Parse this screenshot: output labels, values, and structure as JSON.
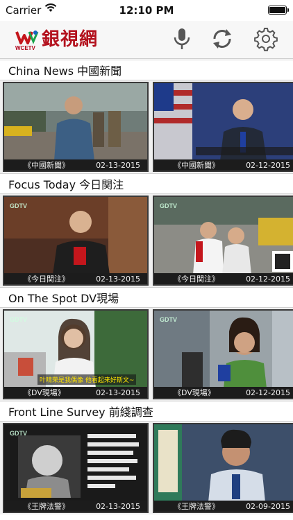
{
  "status_bar": {
    "carrier": "Carrier",
    "time": "12:10 PM"
  },
  "nav": {
    "brand_small": "WCETV",
    "brand_name": "銀視網",
    "icons": [
      "microphone-icon",
      "refresh-icon",
      "gear-icon"
    ]
  },
  "sections": [
    {
      "title": "China News 中國新聞",
      "items": [
        {
          "program": "《中國新聞》",
          "date": "02-13-2015"
        },
        {
          "program": "《中國新聞》",
          "date": "02-12-2015"
        }
      ]
    },
    {
      "title": "Focus Today 今日関注",
      "items": [
        {
          "program": "《今日関注》",
          "date": "02-13-2015"
        },
        {
          "program": "《今日関注》",
          "date": "02-12-2015"
        }
      ]
    },
    {
      "title": "On The Spot DV現場",
      "items": [
        {
          "program": "《DV現場》",
          "date": "02-13-2015",
          "subtitle": "叶晴荣是我偶像 他看起来好斯文~"
        },
        {
          "program": "《DV現場》",
          "date": "02-12-2015"
        }
      ]
    },
    {
      "title": "Front Line Survey 前綫調查",
      "items": [
        {
          "program": "《王牌法警》",
          "date": "02-13-2015"
        },
        {
          "program": "《王牌法警》",
          "date": "02-09-2015"
        }
      ]
    }
  ]
}
